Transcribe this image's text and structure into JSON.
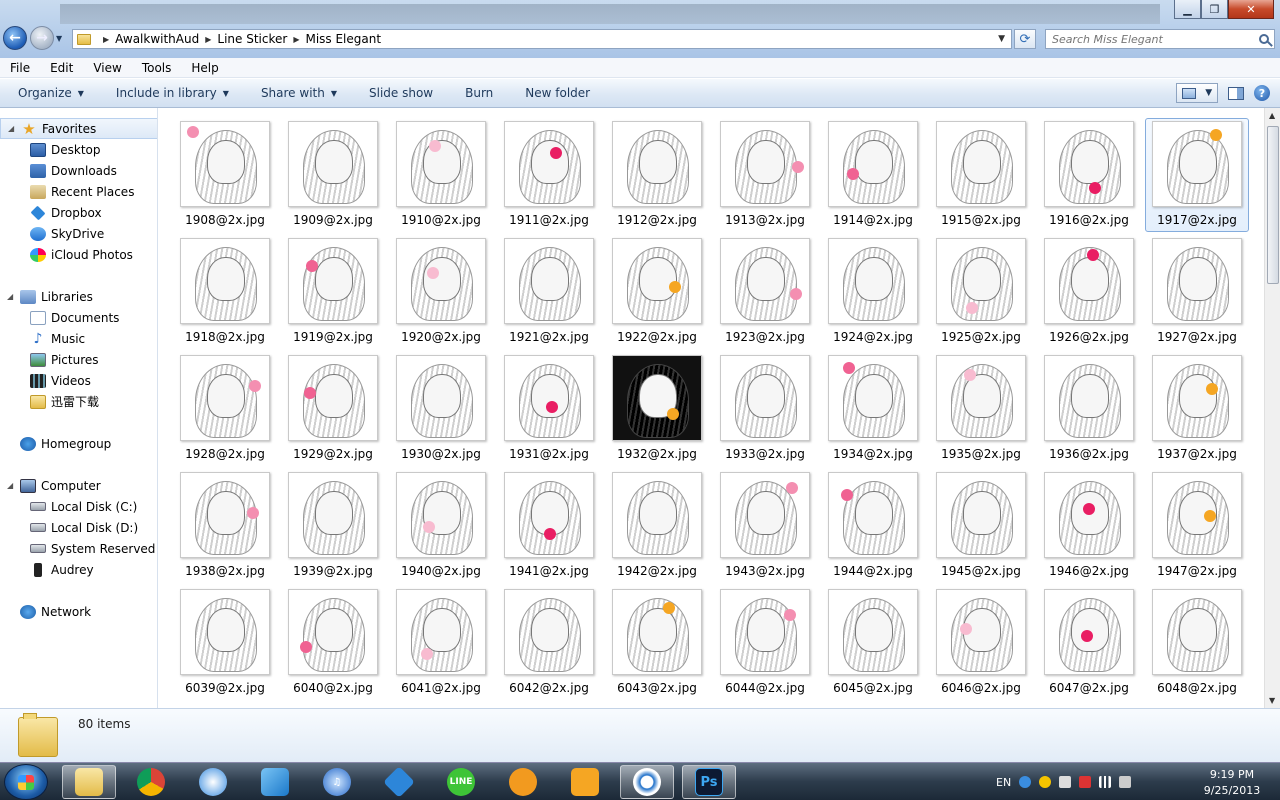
{
  "address": {
    "crumbs": [
      "AwalkwithAud",
      "Line Sticker",
      "Miss Elegant"
    ],
    "search_placeholder": "Search Miss Elegant"
  },
  "menu": [
    "File",
    "Edit",
    "View",
    "Tools",
    "Help"
  ],
  "commands": [
    "Organize",
    "Include in library",
    "Share with",
    "Slide show",
    "Burn",
    "New folder"
  ],
  "nav": {
    "favorites": "Favorites",
    "favorites_items": [
      "Desktop",
      "Downloads",
      "Recent Places",
      "Dropbox",
      "SkyDrive",
      "iCloud Photos"
    ],
    "libraries": "Libraries",
    "libraries_items": [
      "Documents",
      "Music",
      "Pictures",
      "Videos",
      "迅雷下载"
    ],
    "homegroup": "Homegroup",
    "computer": "Computer",
    "computer_items": [
      "Local Disk (C:)",
      "Local Disk (D:)",
      "System Reserved (F:)",
      "Audrey"
    ],
    "network": "Network"
  },
  "files": [
    "1908@2x.jpg",
    "1909@2x.jpg",
    "1910@2x.jpg",
    "1911@2x.jpg",
    "1912@2x.jpg",
    "1913@2x.jpg",
    "1914@2x.jpg",
    "1915@2x.jpg",
    "1916@2x.jpg",
    "1917@2x.jpg",
    "1918@2x.jpg",
    "1919@2x.jpg",
    "1920@2x.jpg",
    "1921@2x.jpg",
    "1922@2x.jpg",
    "1923@2x.jpg",
    "1924@2x.jpg",
    "1925@2x.jpg",
    "1926@2x.jpg",
    "1927@2x.jpg",
    "1928@2x.jpg",
    "1929@2x.jpg",
    "1930@2x.jpg",
    "1931@2x.jpg",
    "1932@2x.jpg",
    "1933@2x.jpg",
    "1934@2x.jpg",
    "1935@2x.jpg",
    "1936@2x.jpg",
    "1937@2x.jpg",
    "1938@2x.jpg",
    "1939@2x.jpg",
    "1940@2x.jpg",
    "1941@2x.jpg",
    "1942@2x.jpg",
    "1943@2x.jpg",
    "1944@2x.jpg",
    "1945@2x.jpg",
    "1946@2x.jpg",
    "1947@2x.jpg",
    "6039@2x.jpg",
    "6040@2x.jpg",
    "6041@2x.jpg",
    "6042@2x.jpg",
    "6043@2x.jpg",
    "6044@2x.jpg",
    "6045@2x.jpg",
    "6046@2x.jpg",
    "6047@2x.jpg",
    "6048@2x.jpg"
  ],
  "selected_file": "1917@2x.jpg",
  "status": {
    "item_count": "80 items"
  },
  "taskbar": {
    "apps": [
      "windows-explorer",
      "chrome",
      "safari",
      "bird-app",
      "itunes",
      "dropbox",
      "line",
      "pps",
      "kingsoft",
      "ie-spin",
      "photoshop"
    ]
  },
  "tray": {
    "language": "EN",
    "time": "9:19 PM",
    "date": "9/25/2013"
  },
  "colors": {
    "accent": "#1e395b",
    "selection": "#84acdd",
    "taskbar": "#2d3c4c"
  }
}
